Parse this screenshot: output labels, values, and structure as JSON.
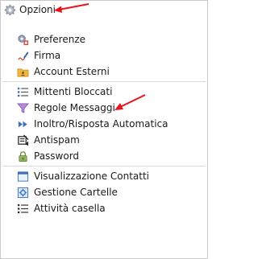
{
  "header": {
    "title": "Opzioni",
    "icon": "gear-icon"
  },
  "groups": [
    [
      {
        "label": "Preferenze",
        "icon": "preferences-icon"
      },
      {
        "label": "Firma",
        "icon": "signature-icon"
      },
      {
        "label": "Account Esterni",
        "icon": "folder-account-icon"
      }
    ],
    [
      {
        "label": "Mittenti Bloccati",
        "icon": "blocked-list-icon"
      },
      {
        "label": "Regole Messaggi",
        "icon": "filter-icon"
      },
      {
        "label": "Inoltro/Risposta Automatica",
        "icon": "forward-icon"
      },
      {
        "label": "Antispam",
        "icon": "antispam-icon"
      },
      {
        "label": "Password",
        "icon": "lock-icon"
      }
    ],
    [
      {
        "label": "Visualizzazione Contatti",
        "icon": "contacts-view-icon"
      },
      {
        "label": "Gestione Cartelle",
        "icon": "folders-icon"
      },
      {
        "label": "Attività casella",
        "icon": "activity-list-icon"
      }
    ]
  ],
  "colors": {
    "annotation_arrow": "#e8141c",
    "separator": "#d9d9d9"
  }
}
